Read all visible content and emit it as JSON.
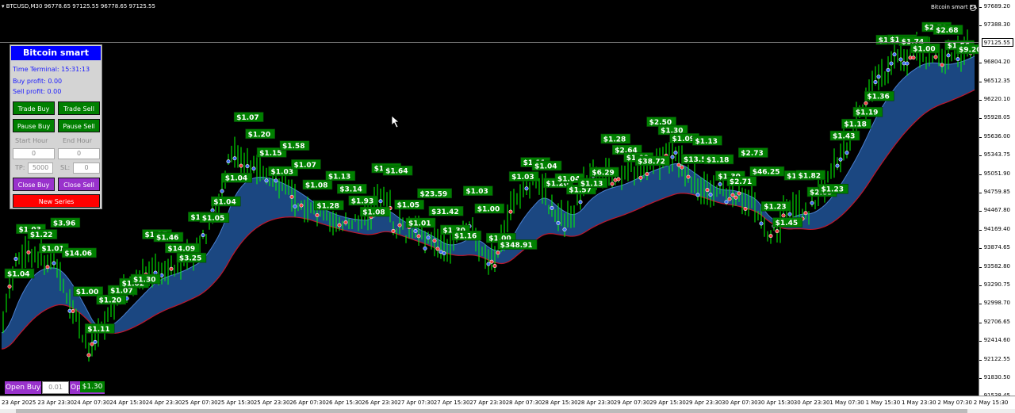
{
  "window": {
    "title": "BTCUSD,M30  96778.65 97125.55 96778.65 97125.55",
    "ea_name": "Bitcoin smart EA"
  },
  "price_axis": {
    "labels": [
      "97689.20",
      "97388.30",
      "97125.55",
      "96804.20",
      "96512.35",
      "96220.10",
      "95928.05",
      "95636.00",
      "95343.75",
      "95051.90",
      "94759.85",
      "94467.80",
      "94169.40",
      "93874.65",
      "93582.80",
      "93290.75",
      "92998.70",
      "92706.65",
      "92414.60",
      "92122.55",
      "91830.50",
      "91538.45"
    ],
    "current_price": "97125.55"
  },
  "time_axis": {
    "labels": [
      "23 Apr 2025",
      "23 Apr 23:30",
      "24 Apr 07:30",
      "24 Apr 15:30",
      "24 Apr 23:30",
      "25 Apr 07:30",
      "25 Apr 15:30",
      "25 Apr 23:30",
      "26 Apr 07:30",
      "26 Apr 15:30",
      "26 Apr 23:30",
      "27 Apr 07:30",
      "27 Apr 15:30",
      "27 Apr 23:30",
      "28 Apr 07:30",
      "28 Apr 15:30",
      "28 Apr 23:30",
      "29 Apr 07:30",
      "29 Apr 15:30",
      "29 Apr 23:30",
      "30 Apr 07:30",
      "30 Apr 15:30",
      "30 Apr 23:30",
      "1 May 07:30",
      "1 May 15:30",
      "1 May 23:30",
      "2 May 07:30",
      "2 May 15:30"
    ]
  },
  "panel": {
    "title": "Bitcoin smart",
    "time_terminal": "Time Terminal: 15:31:13",
    "buy_profit": "Buy profit: 0.00",
    "sell_profit": "Sell profit: 0.00",
    "trade_buy": "Trade Buy",
    "trade_sell": "Trade Sell",
    "pause_buy": "Pause Buy",
    "pause_sell": "Pause Sell",
    "start_hour_label": "Start Hour",
    "end_hour_label": "End Hour",
    "start_hour_value": "0",
    "end_hour_value": "0",
    "tp_label": "TP:",
    "tp_value": "5000",
    "sl_label": "SL:",
    "sl_value": "0",
    "close_buy": "Close Buy",
    "close_sell": "Close Sell",
    "new_series": "New Series"
  },
  "bottom": {
    "open_buy": "Open Buy",
    "lot_value": "0.01",
    "open_sell_partial": "Op",
    "profit_overlay": "$1.30"
  },
  "profit_labels": [
    "$1.04",
    "$1.03",
    "$1.22",
    "$1.01",
    "$3.96",
    "$14.06",
    "$1.00",
    "$1.11",
    "$1.20",
    "$1.07",
    "$1.02",
    "$1.30",
    "$1.17",
    "$1.46",
    "$14.09",
    "$3.25",
    "$1.12",
    "$1.05",
    "$1.04",
    "$1.04",
    "$1.07",
    "$1.20",
    "$1.15",
    "$1.03",
    "$1.58",
    "$1.07",
    "$1.08",
    "$1.28",
    "$1.13",
    "$3.14",
    "$1.93",
    "$1.08",
    "$1.24",
    "$1.64",
    "$1.05",
    "$1.01",
    "$23.59",
    "$31.42",
    "$1.30",
    "$1.16",
    "$1.03",
    "$1.00",
    "$1.00",
    "$348.91",
    "$1.03",
    "$1.11",
    "$1.04",
    "$1.20",
    "$1.04",
    "$1.57",
    "$1.13",
    "$6.29",
    "$1.28",
    "$2.64",
    "$1.09",
    "$38.72",
    "$2.50",
    "$1.30",
    "$1.09",
    "$13.59",
    "$1.13",
    "$1.18",
    "$1.30",
    "$2.71",
    "$2.73",
    "$46.25",
    "$1.23",
    "$1.45",
    "$1.00",
    "$1.82",
    "$2.85",
    "$1.23",
    "$1.43",
    "$1.18",
    "$1.19",
    "$1.36",
    "$1.11",
    "$1.01",
    "$1.74",
    "$1.00",
    "$2.70",
    "$2.68",
    "$1.56",
    "$9.20"
  ],
  "colors": {
    "background": "#000000",
    "profit_label_bg": "#008000",
    "ma_blue": "#1e4f8f",
    "ma_red": "#8b0000",
    "bull_candle": "#00ff00"
  }
}
